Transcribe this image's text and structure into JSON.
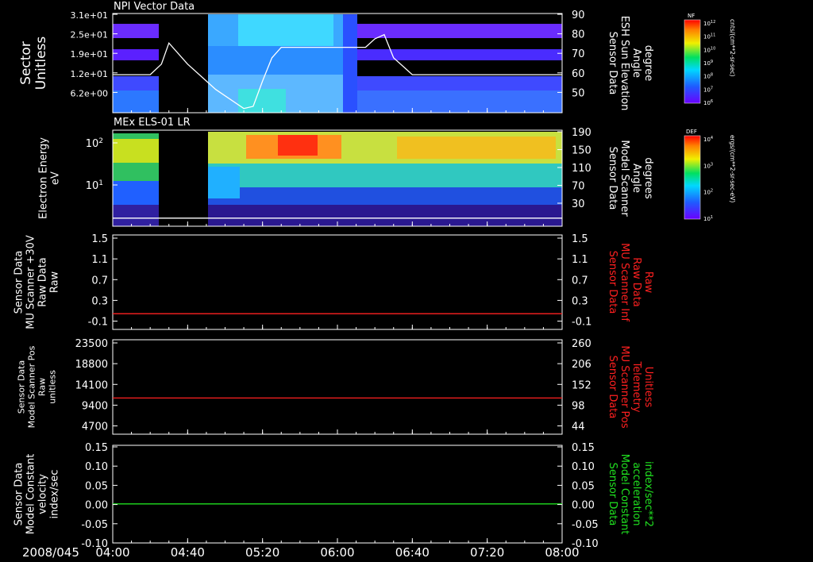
{
  "date_label": "2008/045",
  "time_axis": {
    "ticks": [
      "04:00",
      "04:40",
      "05:20",
      "06:00",
      "06:40",
      "07:20",
      "08:00"
    ],
    "range_minutes": [
      0,
      240
    ]
  },
  "panels": [
    {
      "title": "NPI Vector Data",
      "left_label": [
        "Sector",
        "Unitless"
      ],
      "left_ticks": [
        "3.1e+01",
        "2.5e+01",
        "1.9e+01",
        "1.2e+01",
        "6.2e+00"
      ],
      "right_label": [
        "Sensor Data",
        "ESH Sun Elevation",
        "Angle",
        "degree"
      ],
      "right_ticks": [
        "90",
        "80",
        "70",
        "60",
        "50"
      ],
      "right_color": "#ffffff",
      "colorbar": {
        "name": "NF",
        "units": "cnts/(cm**2-sr-sec)",
        "ticks": [
          "10^12",
          "10^11",
          "10^10",
          "10^9",
          "10^8",
          "10^7",
          "10^6"
        ]
      }
    },
    {
      "title": "MEx ELS-01 LR",
      "left_label": [
        "Electron Energy",
        "eV"
      ],
      "left_ticks": [
        "10^2",
        "10^1"
      ],
      "right_label": [
        "Sensor Data",
        "Model Scanner",
        "Angle",
        "degrees"
      ],
      "right_ticks": [
        "190",
        "150",
        "110",
        "70",
        "30"
      ],
      "right_color": "#ffffff",
      "colorbar": {
        "name": "DEF",
        "units": "ergs/(cm**2-sr-sec-eV)",
        "ticks": [
          "10^4",
          "10^3",
          "10^2",
          "10^1"
        ]
      }
    },
    {
      "left_label": [
        "Sensor Data",
        "MU Scanner +30V",
        "Raw Data",
        "Raw"
      ],
      "left_ticks": [
        "1.5",
        "1.1",
        "0.7",
        "0.3",
        "-0.1"
      ],
      "right_label": [
        "Sensor Data",
        "MU Scanner Inf",
        "Raw Data",
        "Raw"
      ],
      "right_ticks": [
        "1.5",
        "1.1",
        "0.7",
        "0.3",
        "-0.1"
      ],
      "right_color": "#ff2020"
    },
    {
      "left_label": [
        "Sensor Data",
        "Model Scanner Pos",
        "Raw",
        "unitless"
      ],
      "left_ticks": [
        "23500",
        "18800",
        "14100",
        "9400",
        "4700"
      ],
      "right_label": [
        "Sensor Data",
        "MU Scanner Pos",
        "Telemetry",
        "Unitless"
      ],
      "right_ticks": [
        "260",
        "206",
        "152",
        "98",
        "44"
      ],
      "right_color": "#ff2020"
    },
    {
      "left_label": [
        "Sensor Data",
        "Model Constant",
        "velocity",
        "index/sec"
      ],
      "left_ticks": [
        "0.15",
        "0.10",
        "0.05",
        "0.00",
        "-0.05",
        "-0.10"
      ],
      "right_label": [
        "Sensor Data",
        "Model Constant",
        "acceleration",
        "index/sec**2"
      ],
      "right_ticks": [
        "0.15",
        "0.10",
        "0.05",
        "0.00",
        "-0.05",
        "-0.10"
      ],
      "right_color": "#20e020"
    }
  ],
  "chart_data": [
    {
      "type": "line",
      "series": [
        {
          "x_minutes": [
            0,
            20,
            26,
            30,
            40,
            55,
            70,
            75,
            80,
            85,
            90,
            100,
            110,
            115,
            120,
            135,
            140,
            145,
            150,
            160,
            180,
            200,
            220,
            240
          ],
          "values": [
            61,
            61,
            66,
            76,
            66,
            54,
            45,
            46,
            58,
            69,
            74,
            74,
            74,
            74,
            74,
            74,
            78,
            80,
            69,
            61,
            61,
            61,
            61,
            61
          ]
        }
      ],
      "ylim": [
        43,
        90
      ]
    },
    {
      "type": "line",
      "series": [
        {
          "values": [
            16,
            16
          ]
        }
      ],
      "ylim": [
        0,
        190
      ]
    },
    {
      "type": "line",
      "series": [
        {
          "values": [
            0.0,
            0.0
          ]
        }
      ],
      "ylim": [
        -0.3,
        1.5
      ]
    },
    {
      "type": "line",
      "series": [
        {
          "values": [
            9000,
            9000
          ]
        }
      ],
      "ylim": [
        0,
        23500
      ]
    },
    {
      "type": "line",
      "series": [
        {
          "values": [
            0.0,
            0.0
          ]
        }
      ],
      "ylim": [
        -0.1,
        0.15
      ]
    }
  ]
}
